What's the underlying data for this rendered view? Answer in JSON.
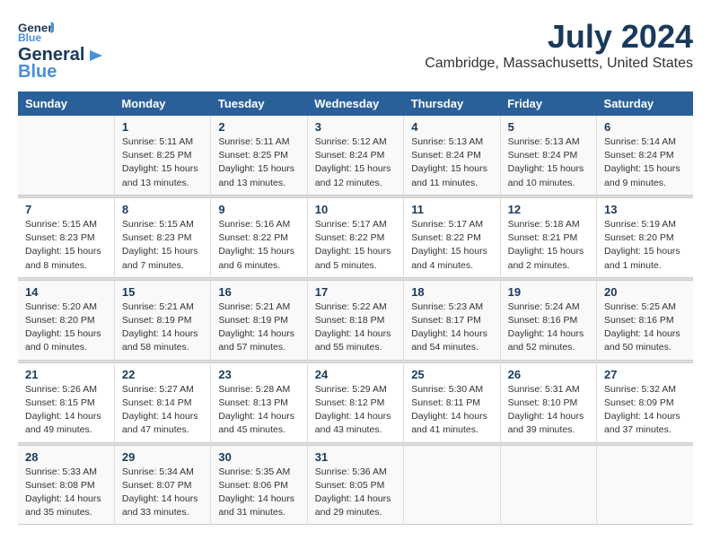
{
  "header": {
    "logo_general": "General",
    "logo_blue": "Blue",
    "title": "July 2024",
    "subtitle": "Cambridge, Massachusetts, United States"
  },
  "weekdays": [
    "Sunday",
    "Monday",
    "Tuesday",
    "Wednesday",
    "Thursday",
    "Friday",
    "Saturday"
  ],
  "weeks": [
    [
      {
        "num": "",
        "info": ""
      },
      {
        "num": "1",
        "info": "Sunrise: 5:11 AM\nSunset: 8:25 PM\nDaylight: 15 hours\nand 13 minutes."
      },
      {
        "num": "2",
        "info": "Sunrise: 5:11 AM\nSunset: 8:25 PM\nDaylight: 15 hours\nand 13 minutes."
      },
      {
        "num": "3",
        "info": "Sunrise: 5:12 AM\nSunset: 8:24 PM\nDaylight: 15 hours\nand 12 minutes."
      },
      {
        "num": "4",
        "info": "Sunrise: 5:13 AM\nSunset: 8:24 PM\nDaylight: 15 hours\nand 11 minutes."
      },
      {
        "num": "5",
        "info": "Sunrise: 5:13 AM\nSunset: 8:24 PM\nDaylight: 15 hours\nand 10 minutes."
      },
      {
        "num": "6",
        "info": "Sunrise: 5:14 AM\nSunset: 8:24 PM\nDaylight: 15 hours\nand 9 minutes."
      }
    ],
    [
      {
        "num": "7",
        "info": "Sunrise: 5:15 AM\nSunset: 8:23 PM\nDaylight: 15 hours\nand 8 minutes."
      },
      {
        "num": "8",
        "info": "Sunrise: 5:15 AM\nSunset: 8:23 PM\nDaylight: 15 hours\nand 7 minutes."
      },
      {
        "num": "9",
        "info": "Sunrise: 5:16 AM\nSunset: 8:22 PM\nDaylight: 15 hours\nand 6 minutes."
      },
      {
        "num": "10",
        "info": "Sunrise: 5:17 AM\nSunset: 8:22 PM\nDaylight: 15 hours\nand 5 minutes."
      },
      {
        "num": "11",
        "info": "Sunrise: 5:17 AM\nSunset: 8:22 PM\nDaylight: 15 hours\nand 4 minutes."
      },
      {
        "num": "12",
        "info": "Sunrise: 5:18 AM\nSunset: 8:21 PM\nDaylight: 15 hours\nand 2 minutes."
      },
      {
        "num": "13",
        "info": "Sunrise: 5:19 AM\nSunset: 8:20 PM\nDaylight: 15 hours\nand 1 minute."
      }
    ],
    [
      {
        "num": "14",
        "info": "Sunrise: 5:20 AM\nSunset: 8:20 PM\nDaylight: 15 hours\nand 0 minutes."
      },
      {
        "num": "15",
        "info": "Sunrise: 5:21 AM\nSunset: 8:19 PM\nDaylight: 14 hours\nand 58 minutes."
      },
      {
        "num": "16",
        "info": "Sunrise: 5:21 AM\nSunset: 8:19 PM\nDaylight: 14 hours\nand 57 minutes."
      },
      {
        "num": "17",
        "info": "Sunrise: 5:22 AM\nSunset: 8:18 PM\nDaylight: 14 hours\nand 55 minutes."
      },
      {
        "num": "18",
        "info": "Sunrise: 5:23 AM\nSunset: 8:17 PM\nDaylight: 14 hours\nand 54 minutes."
      },
      {
        "num": "19",
        "info": "Sunrise: 5:24 AM\nSunset: 8:16 PM\nDaylight: 14 hours\nand 52 minutes."
      },
      {
        "num": "20",
        "info": "Sunrise: 5:25 AM\nSunset: 8:16 PM\nDaylight: 14 hours\nand 50 minutes."
      }
    ],
    [
      {
        "num": "21",
        "info": "Sunrise: 5:26 AM\nSunset: 8:15 PM\nDaylight: 14 hours\nand 49 minutes."
      },
      {
        "num": "22",
        "info": "Sunrise: 5:27 AM\nSunset: 8:14 PM\nDaylight: 14 hours\nand 47 minutes."
      },
      {
        "num": "23",
        "info": "Sunrise: 5:28 AM\nSunset: 8:13 PM\nDaylight: 14 hours\nand 45 minutes."
      },
      {
        "num": "24",
        "info": "Sunrise: 5:29 AM\nSunset: 8:12 PM\nDaylight: 14 hours\nand 43 minutes."
      },
      {
        "num": "25",
        "info": "Sunrise: 5:30 AM\nSunset: 8:11 PM\nDaylight: 14 hours\nand 41 minutes."
      },
      {
        "num": "26",
        "info": "Sunrise: 5:31 AM\nSunset: 8:10 PM\nDaylight: 14 hours\nand 39 minutes."
      },
      {
        "num": "27",
        "info": "Sunrise: 5:32 AM\nSunset: 8:09 PM\nDaylight: 14 hours\nand 37 minutes."
      }
    ],
    [
      {
        "num": "28",
        "info": "Sunrise: 5:33 AM\nSunset: 8:08 PM\nDaylight: 14 hours\nand 35 minutes."
      },
      {
        "num": "29",
        "info": "Sunrise: 5:34 AM\nSunset: 8:07 PM\nDaylight: 14 hours\nand 33 minutes."
      },
      {
        "num": "30",
        "info": "Sunrise: 5:35 AM\nSunset: 8:06 PM\nDaylight: 14 hours\nand 31 minutes."
      },
      {
        "num": "31",
        "info": "Sunrise: 5:36 AM\nSunset: 8:05 PM\nDaylight: 14 hours\nand 29 minutes."
      },
      {
        "num": "",
        "info": ""
      },
      {
        "num": "",
        "info": ""
      },
      {
        "num": "",
        "info": ""
      }
    ]
  ]
}
